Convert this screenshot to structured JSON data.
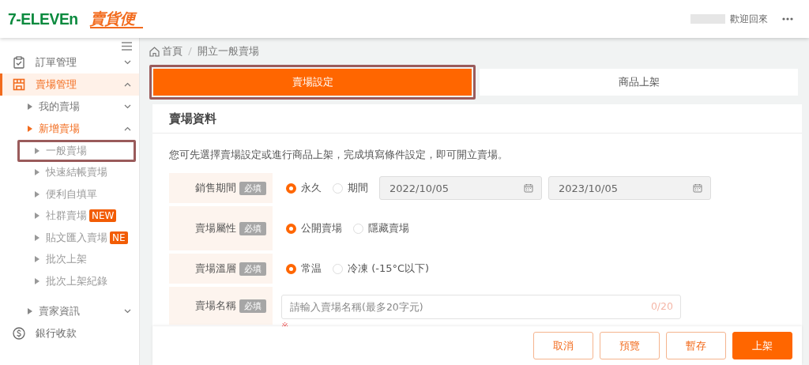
{
  "header": {
    "logo": "7-ELEVEn",
    "brand": "賣貨便",
    "greeting": "歡迎回來"
  },
  "sidebar": {
    "items": [
      {
        "label": "訂單管理",
        "expanded": false,
        "selected": false
      },
      {
        "label": "賣場管理",
        "expanded": true,
        "selected": true,
        "children": [
          {
            "label": "我的賣場",
            "expanded": false,
            "selected": false
          },
          {
            "label": "新增賣場",
            "expanded": true,
            "selected": true,
            "children": [
              {
                "label": "一般賣場",
                "selected": false,
                "highlighted": true
              },
              {
                "label": "快速結帳賣場",
                "selected": false,
                "highlighted": false
              },
              {
                "label": "便利自填單",
                "selected": false,
                "highlighted": false
              },
              {
                "label": "社群賣場",
                "selected": false,
                "highlighted": false,
                "badge": "NEW"
              },
              {
                "label": "貼文匯入賣場",
                "selected": false,
                "highlighted": false,
                "badge": "NE"
              },
              {
                "label": "批次上架",
                "selected": false,
                "highlighted": false
              },
              {
                "label": "批次上架紀錄",
                "selected": false,
                "highlighted": false
              }
            ]
          },
          {
            "label": "賣家資訊",
            "expanded": false,
            "selected": false
          }
        ]
      },
      {
        "label": "銀行收款",
        "selected": false
      }
    ]
  },
  "breadcrumb": [
    "首頁",
    "開立一般賣場"
  ],
  "tabs": [
    {
      "label": "賣場設定",
      "selected": true,
      "highlighted": true
    },
    {
      "label": "商品上架",
      "selected": false,
      "highlighted": false
    }
  ],
  "card": {
    "title": "賣場資料",
    "description": "您可先選擇賣場設定或進行商品上架，完成填寫條件設定，即可開立賣場。",
    "rows": [
      {
        "kind": "radio",
        "label": "銷售期間",
        "required": "必填",
        "options": [
          {
            "label": "永久",
            "selected": true
          },
          {
            "label": "期間",
            "selected": false
          }
        ],
        "dates": [
          {
            "value": "2022/10/05",
            "disabled": true
          },
          {
            "value": "2023/10/05",
            "disabled": true
          }
        ]
      },
      {
        "kind": "radio",
        "label": "賣場屬性",
        "required": "必填",
        "options": [
          {
            "label": "公開賣場",
            "selected": true
          },
          {
            "label": "隱藏賣場",
            "selected": false
          }
        ]
      },
      {
        "kind": "radio",
        "label": "賣場溫層",
        "required": "必填",
        "options": [
          {
            "label": "常温",
            "selected": true
          },
          {
            "label": "冷凍 (-15°C以下)",
            "selected": false
          }
        ]
      },
      {
        "kind": "text",
        "label": "賣場名稱",
        "required": "必填",
        "placeholder": "請輸入賣場名稱(最多20字元)",
        "counter": "0/20",
        "hint": "※"
      }
    ]
  },
  "footer": {
    "buttons": [
      {
        "label": "取消",
        "kind": "outline"
      },
      {
        "label": "預覽",
        "kind": "outline"
      },
      {
        "label": "暫存",
        "kind": "outline"
      },
      {
        "label": "上架",
        "kind": "primary"
      }
    ]
  }
}
